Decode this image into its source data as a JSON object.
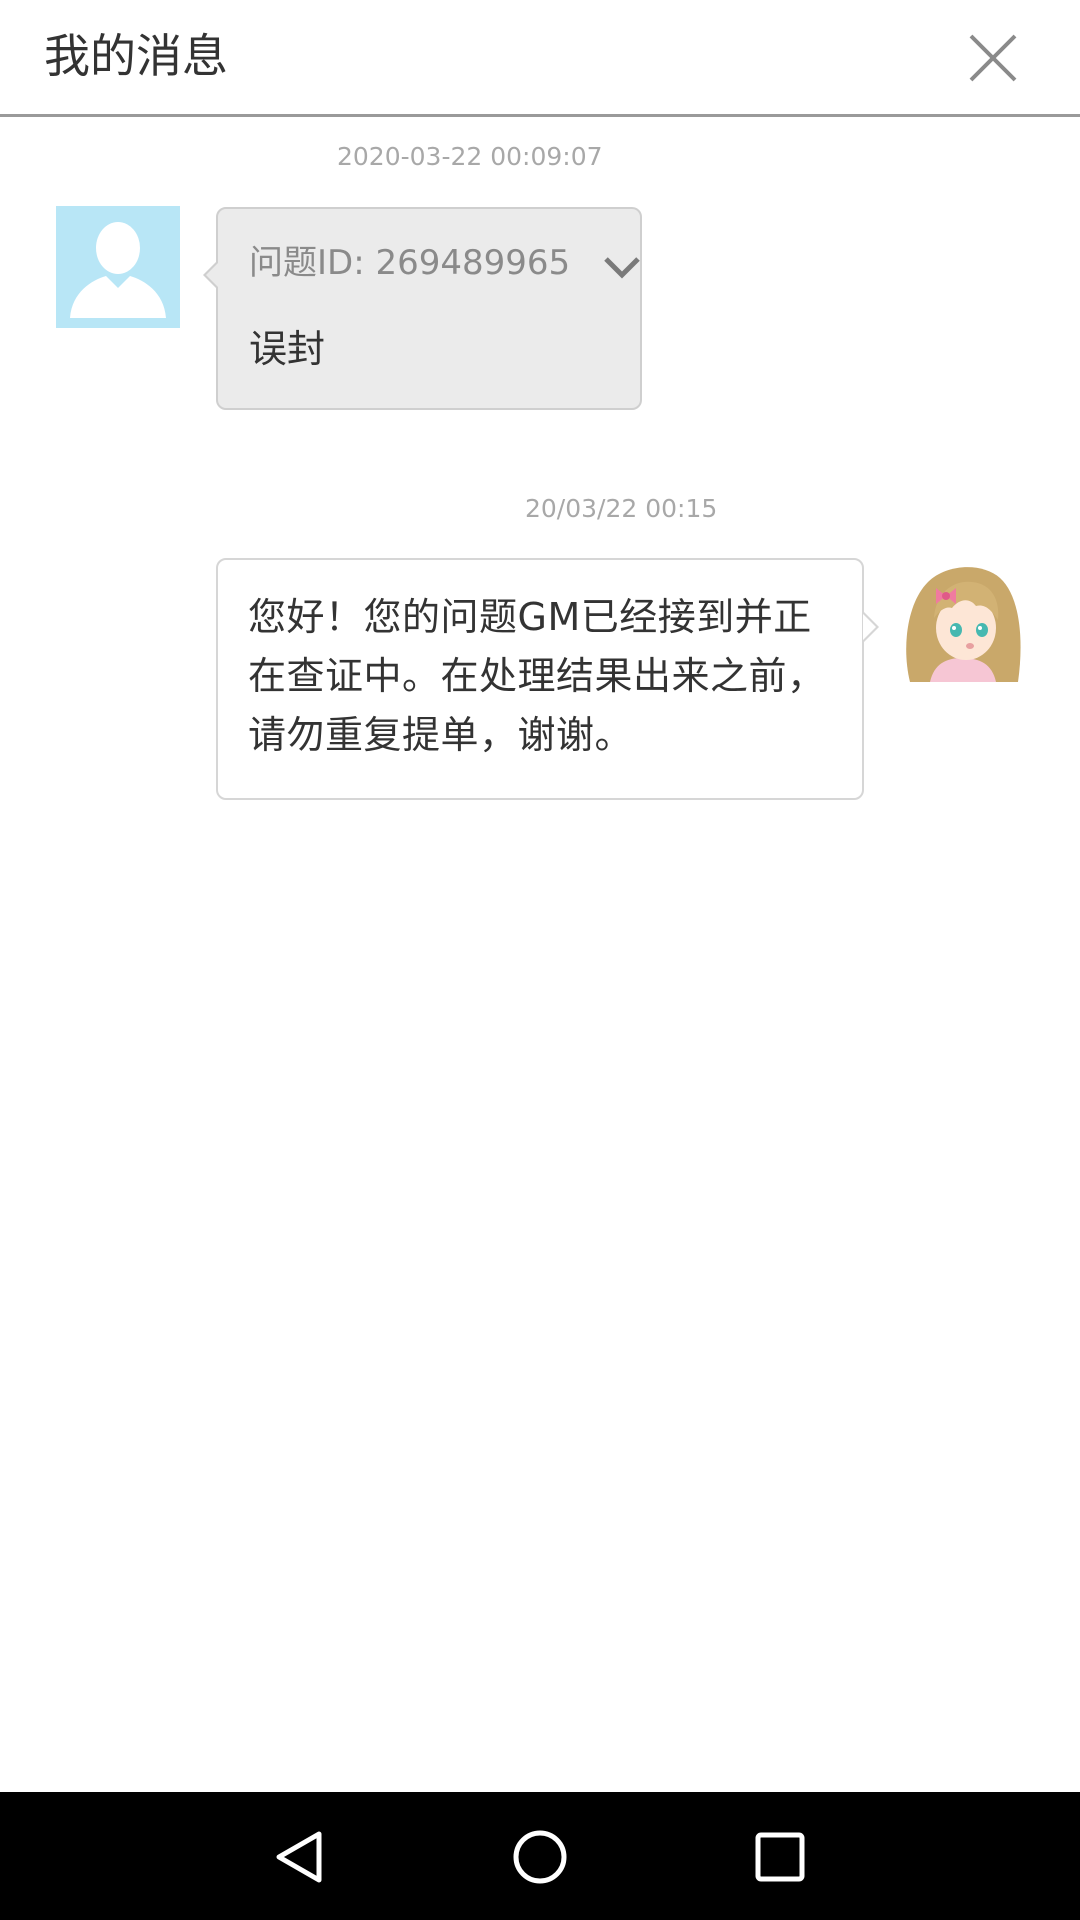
{
  "header": {
    "title": "我的消息"
  },
  "messages": [
    {
      "timestamp": "2020-03-22 00:09:07",
      "sender": "user",
      "question_id_label": "问题ID: 269489965",
      "text": "误封"
    },
    {
      "timestamp": "20/03/22 00:15",
      "sender": "gm",
      "text": "您好！您的问题GM已经接到并正在查证中。在处理结果出来之前，请勿重复提单，谢谢。"
    }
  ],
  "icons": {
    "close": "close-icon",
    "expand": "chevron-down-icon",
    "user_avatar": "default-avatar-icon",
    "gm_avatar": "gm-avatar",
    "back": "back-triangle-icon",
    "home": "home-circle-icon",
    "recent": "recent-square-icon"
  },
  "colors": {
    "header_divider": "#9a9a9a",
    "user_bubble_bg": "#ebebeb",
    "gm_bubble_bg": "#ffffff",
    "avatar_bg": "#b8e6f6",
    "timestamp": "#a8a8a8",
    "navbar_bg": "#000000"
  }
}
